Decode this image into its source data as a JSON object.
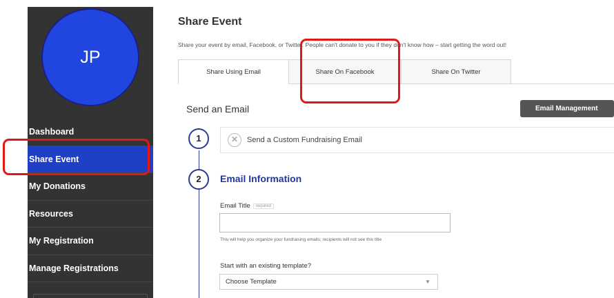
{
  "sidebar": {
    "avatar_initials": "JP",
    "items": [
      {
        "label": "Dashboard",
        "active": false
      },
      {
        "label": "Share Event",
        "active": true
      },
      {
        "label": "My Donations",
        "active": false
      },
      {
        "label": "Resources",
        "active": false
      },
      {
        "label": "My Registration",
        "active": false
      },
      {
        "label": "Manage Registrations",
        "active": false
      }
    ]
  },
  "page": {
    "title": "Share Event",
    "intro": "Share your event by email, Facebook, or Twitter. People can't donate to you if they don't know how – start getting the word out!"
  },
  "tabs": [
    {
      "label": "Share Using Email",
      "active": true
    },
    {
      "label": "Share On Facebook",
      "active": false
    },
    {
      "label": "Share On Twitter",
      "active": false
    }
  ],
  "email": {
    "heading": "Send an Email",
    "management_button": "Email Management",
    "step1": {
      "number": "1",
      "label": "Send a Custom Fundraising Email",
      "icon": "close-circle-icon"
    },
    "step2": {
      "number": "2",
      "title": "Email Information"
    },
    "email_title_label": "Email Title",
    "required_badge": "required",
    "email_title_value": "",
    "email_title_help": "This will help you organize your fundraising emails; recipients will not see this title",
    "template_label": "Start with an existing template?",
    "template_selected": "Choose Template"
  },
  "colors": {
    "sidebar_bg": "#333333",
    "sidebar_active": "#1f3fc7",
    "avatar": "#2146e0",
    "accent": "#2138a0",
    "highlight_box": "#e01818"
  }
}
